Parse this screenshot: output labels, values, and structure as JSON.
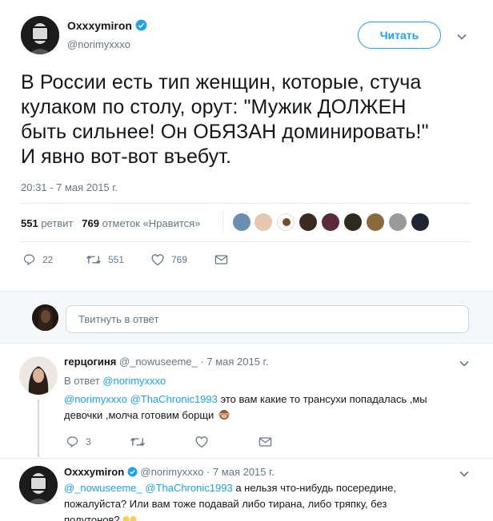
{
  "main_tweet": {
    "author_name": "Oxxxymiron",
    "author_handle": "@norimyxxxo",
    "follow_label": "Читать",
    "text": "В России есть тип женщин, которые, стуча\nкулаком по столу, орут: \"Мужик ДОЛЖЕН\nбыть сильнее! Он ОБЯЗАН доминировать!\"\nИ явно вот-вот въебут.",
    "timestamp": "20:31 - 7 мая 2015 г.",
    "retweets_count": "551",
    "retweets_label": "ретвит",
    "likes_count": "769",
    "likes_label": "отметок «Нравится»",
    "actions": {
      "reply_count": "22",
      "retweet_count": "551",
      "like_count": "769"
    }
  },
  "reply_box": {
    "placeholder": "Твитнуть в ответ"
  },
  "replies": [
    {
      "author_name": "герцогиня",
      "author_handle": "@_nowuseeme_",
      "separator": "·",
      "date": "7 мая 2015 г.",
      "in_reply_prefix": "В ответ",
      "in_reply_handle": "@norimyxxxo",
      "mention1": "@norimyxxxo",
      "mention2": "@ThaChronic1993",
      "text_line1": "это вам какие то трансухи попадалась ,мы",
      "text_line2": "девочки ,молча готовим борщи",
      "emoji": "see-no-evil-monkey",
      "reply_count": "3"
    },
    {
      "author_name": "Oxxxymiron",
      "author_handle": "@norimyxxxo",
      "separator": "·",
      "date": "7 мая 2015 г.",
      "mention1": "@_nowuseeme_",
      "mention2": "@ThaChronic1993",
      "text_line1": "а нельзя что-нибудь посередине,",
      "text_line2": "пожалуйста? Или вам тоже подавай либо тирана, либо тряпку, без",
      "text_line3": "полутонов?",
      "emoji": "crying-face"
    }
  ],
  "colors": {
    "accent": "#1da1f2",
    "muted": "#657786",
    "text": "#14171a",
    "border": "#e6ecf0"
  }
}
